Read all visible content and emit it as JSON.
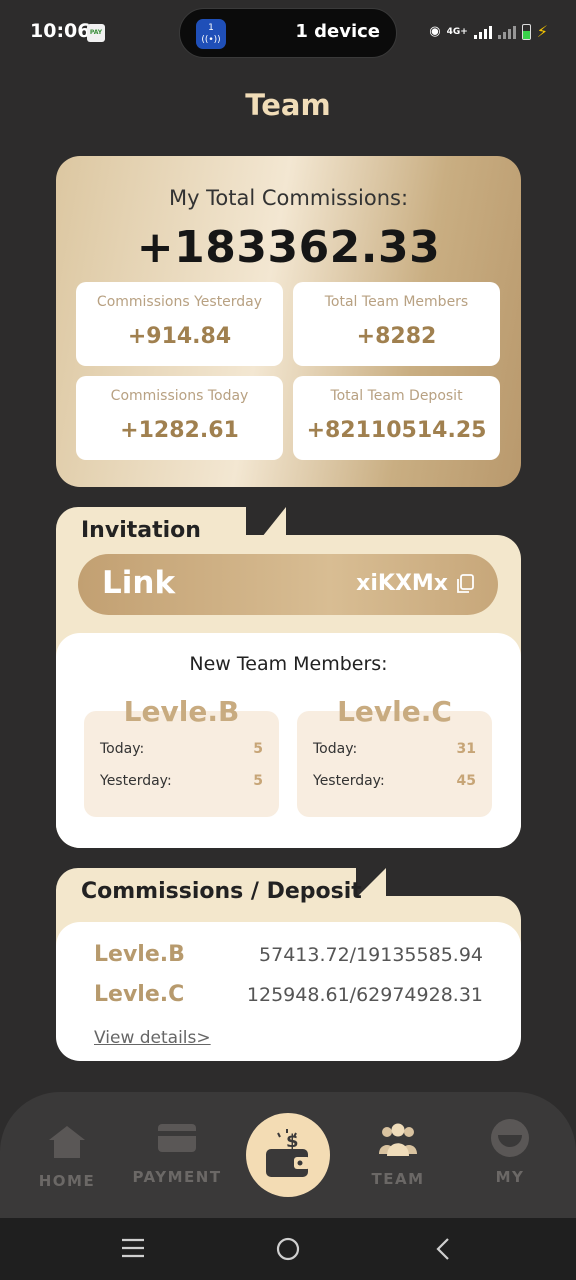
{
  "status": {
    "time": "10:06",
    "pay_badge": "PAY",
    "device_label": "1 device",
    "device_count": "1",
    "network": "4G+"
  },
  "page": {
    "title": "Team"
  },
  "commissions": {
    "label": "My Total Commissions:",
    "total": "+183362.33",
    "stats": [
      {
        "label": "Commissions Yesterday",
        "value": "+914.84"
      },
      {
        "label": "Total Team Members",
        "value": "+8282"
      },
      {
        "label": "Commissions Today",
        "value": "+1282.61"
      },
      {
        "label": "Total Team Deposit",
        "value": "+82110514.25"
      }
    ]
  },
  "invitation": {
    "title": "Invitation",
    "link_label": "Link",
    "code": "xiKXMx",
    "members_title": "New Team Members:",
    "levels": [
      {
        "name": "Levle.B",
        "today_label": "Today:",
        "today": "5",
        "yesterday_label": "Yesterday:",
        "yesterday": "5"
      },
      {
        "name": "Levle.C",
        "today_label": "Today:",
        "today": "31",
        "yesterday_label": "Yesterday:",
        "yesterday": "45"
      }
    ]
  },
  "commissions_deposit": {
    "title": "Commissions / Deposit",
    "rows": [
      {
        "level": "Levle.B",
        "value": "57413.72/19135585.94"
      },
      {
        "level": "Levle.C",
        "value": "125948.61/62974928.31"
      }
    ],
    "view_details": "View details>"
  },
  "nav": {
    "items": [
      {
        "label": "HOME",
        "icon": "home-icon"
      },
      {
        "label": "PAYMENT",
        "icon": "card-icon"
      },
      {
        "label": "",
        "icon": "wallet-icon"
      },
      {
        "label": "TEAM",
        "icon": "team-icon"
      },
      {
        "label": "MY",
        "icon": "profile-icon"
      }
    ],
    "active": "TEAM"
  },
  "colors": {
    "accent": "#b79a6d",
    "background": "#2d2c2c",
    "title": "#f1ddb8",
    "card_tint": "#f3e7cc"
  }
}
